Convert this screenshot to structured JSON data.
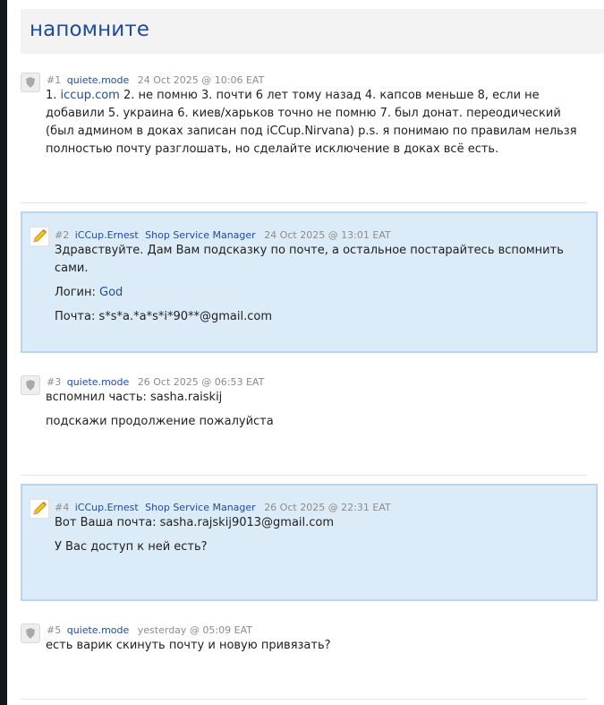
{
  "thread": {
    "title": "напомните"
  },
  "posts": [
    {
      "num": "#1",
      "user": "quiete.mode",
      "date": "24 Oct 2025 @ 10:06 EAT",
      "link": "iccup.com",
      "text_after_link": " 2. не помню 3. почти 6 лет тому назад 4. капсов меньше 8, если не добавили 5. украина 6. киев/харьков точно не помню 7. был донат. переодический (был админом в доках записан под iCCup.Nirvana) p.s. я понимаю по правилам нельзя полностью почту разглошать, но сделайте исключение в доках всё есть.",
      "text_before_link": "1. "
    },
    {
      "num": "#2",
      "user": "iCCup.Ernest",
      "role": "Shop Service Manager",
      "date": "24 Oct 2025 @ 13:01 EAT",
      "line1": "Здравствуйте. Дам Вам подсказку по почте, а остальное постарайтесь вспомнить сами.",
      "login_label": "Логин: ",
      "login_value": "God",
      "mail_line": "Почта: s*s*a.*a*s*i*90**@gmail.com"
    },
    {
      "num": "#3",
      "user": "quiete.mode",
      "date": "26 Oct 2025 @ 06:53 EAT",
      "line1": "вспомнил часть: sasha.raiskij",
      "line2": "подскажи продолжение пожалуйста"
    },
    {
      "num": "#4",
      "user": "iCCup.Ernest",
      "role": "Shop Service Manager",
      "date": "26 Oct 2025 @ 22:31 EAT",
      "line1": "Вот Ваша почта: sasha.rajskij9013@gmail.com",
      "line2": "У Вас доступ к ней есть?"
    },
    {
      "num": "#5",
      "user": "quiete.mode",
      "date": "yesterday @ 05:09 EAT",
      "line1": "есть варик скинуть почту и новую привязать?"
    }
  ],
  "colors": {
    "accent": "#1e4c9a",
    "staff_bg": "#dcebf8",
    "staff_border": "#b8d6ef"
  },
  "icons": {
    "user_avatar": "shield-icon",
    "staff_avatar": "pencil-icon"
  }
}
